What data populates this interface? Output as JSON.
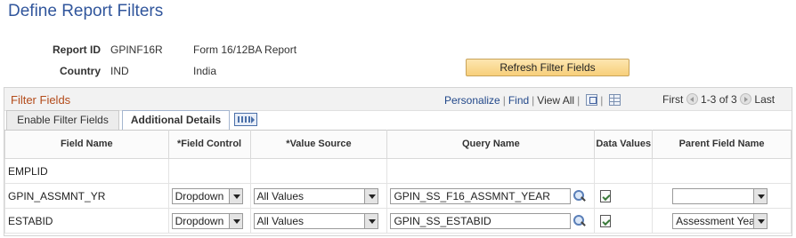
{
  "page": {
    "title": "Define Report Filters"
  },
  "info": {
    "report_id_label": "Report ID",
    "report_id_value": "GPINF16R",
    "report_id_desc": "Form 16/12BA Report",
    "country_label": "Country",
    "country_value": "IND",
    "country_desc": "India"
  },
  "refresh_button": "Refresh Filter Fields",
  "grid": {
    "title": "Filter Fields",
    "personalize": "Personalize",
    "find": "Find",
    "view_all": "View All",
    "first": "First",
    "range": "1-3 of 3",
    "last": "Last",
    "tabs": [
      "Enable Filter Fields",
      "Additional Details"
    ],
    "columns": [
      "Field Name",
      "*Field Control",
      "*Value Source",
      "Query Name",
      "Data Values",
      "Parent Field Name"
    ],
    "rows": [
      {
        "field_name": "EMPLID",
        "field_control": "",
        "value_source": "",
        "query_name": "",
        "parent_field": ""
      },
      {
        "field_name": "GPIN_ASSMNT_YR",
        "field_control": "Dropdown",
        "value_source": "All Values",
        "query_name": "GPIN_SS_F16_ASSMNT_YEAR",
        "parent_field": ""
      },
      {
        "field_name": "ESTABID",
        "field_control": "Dropdown",
        "value_source": "All Values",
        "query_name": "GPIN_SS_ESTABID",
        "parent_field": "Assessment Year"
      }
    ]
  },
  "icons": [
    "zoom-icon",
    "grid-view-icon",
    "first-arrow-icon",
    "last-arrow-icon",
    "lookup-icon",
    "data-values-icon",
    "show-all-tabs-icon"
  ]
}
